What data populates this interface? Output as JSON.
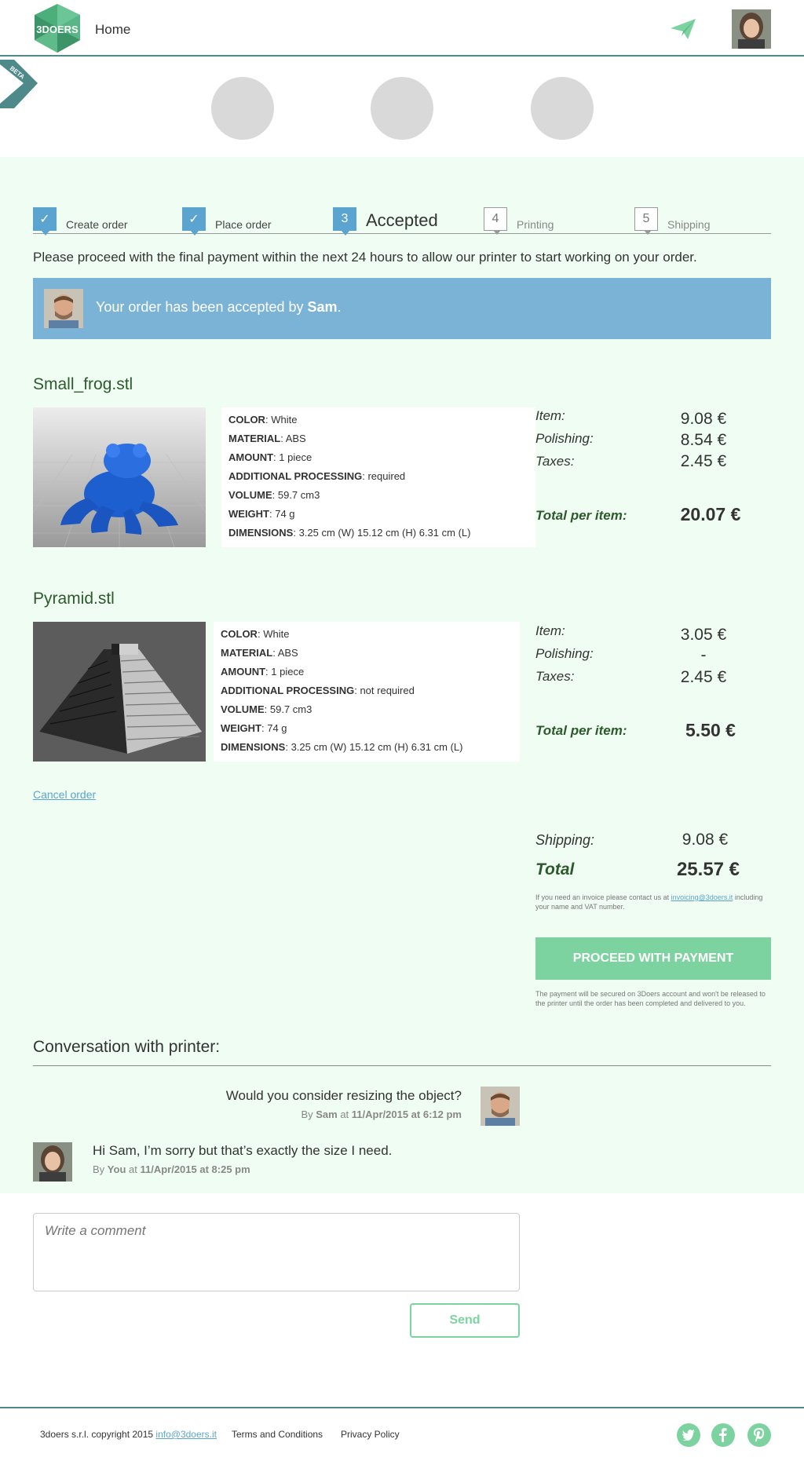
{
  "header": {
    "logo_text": "3DOERS",
    "home_label": "Home",
    "beta_label": "BETA"
  },
  "steps": [
    {
      "number": "✓",
      "label": "Create order",
      "state": "done"
    },
    {
      "number": "✓",
      "label": "Place order",
      "state": "done"
    },
    {
      "number": "3",
      "label": "Accepted",
      "state": "active"
    },
    {
      "number": "4",
      "label": "Printing",
      "state": "todo"
    },
    {
      "number": "5",
      "label": "Shipping",
      "state": "todo"
    }
  ],
  "proceed_note": "Please proceed with the final payment within the next 24 hours to allow our printer to start working on your order.",
  "banner": {
    "text_prefix": "Your order has been accepted by ",
    "printer_name": "Sam",
    "text_suffix": "."
  },
  "items": [
    {
      "title": "Small_frog.stl",
      "details": [
        {
          "label": "COLOR",
          "sep": ": ",
          "value": "White"
        },
        {
          "label": "MATERIAL",
          "sep": ": ",
          "value": "ABS"
        },
        {
          "label": "AMOUNT",
          "sep": ":  ",
          "value": "1 piece"
        },
        {
          "label": "ADDITIONAL PROCESSING",
          "sep": ":  ",
          "value": "required"
        },
        {
          "label": "VOLUME",
          "sep": ": ",
          "value": "59.7 cm3"
        },
        {
          "label": "WEIGHT",
          "sep": ": ",
          "value": "74 g"
        },
        {
          "label": "DIMENSIONS",
          "sep": ": ",
          "value": "3.25 cm (W) 15.12 cm (H) 6.31 cm (L)"
        }
      ],
      "item_label": "Item:",
      "item_price": "9.08 €",
      "polishing_label": "Polishing:",
      "polishing_price": "8.54 €",
      "taxes_label": "Taxes:",
      "taxes_price": "2.45 €",
      "total_label": "Total per item:",
      "total_price": "20.07 €"
    },
    {
      "title": "Pyramid.stl",
      "details": [
        {
          "label": "COLOR",
          "sep": ": ",
          "value": "White"
        },
        {
          "label": "MATERIAL",
          "sep": ": ",
          "value": "ABS"
        },
        {
          "label": "AMOUNT",
          "sep": ":  ",
          "value": "1 piece"
        },
        {
          "label": "ADDITIONAL PROCESSING",
          "sep": ":  ",
          "value": "not required"
        },
        {
          "label": "VOLUME",
          "sep": ": ",
          "value": "59.7 cm3"
        },
        {
          "label": "WEIGHT",
          "sep": ": ",
          "value": "74 g"
        },
        {
          "label": "DIMENSIONS",
          "sep": ": ",
          "value": "3.25 cm (W) 15.12 cm (H) 6.31 cm (L)"
        }
      ],
      "item_label": "Item:",
      "item_price": "3.05 €",
      "polishing_label": "Polishing:",
      "polishing_price": "-",
      "taxes_label": "Taxes:",
      "taxes_price": "2.45 €",
      "total_label": "Total per item:",
      "total_price": "5.50 €"
    }
  ],
  "cancel_order_label": "Cancel order",
  "summary": {
    "shipping_label": "Shipping:",
    "shipping_price": "9.08 €",
    "total_label": "Total",
    "total_price": "25.57 €",
    "invoice_note_prefix": "If you need an invoice please contact us at ",
    "invoice_email": "invoicing@3doers.it",
    "invoice_note_suffix": " including your name and VAT number.",
    "pay_button_label": "PROCEED WITH PAYMENT",
    "pay_note": "The payment will be secured on 3Doers account and won't be released to the printer until the order has been completed and delivered to you."
  },
  "conversation": {
    "title": "Conversation with printer:",
    "messages": [
      {
        "text": "Would you consider resizing the object?",
        "by": "By ",
        "author": "Sam",
        "at": " at ",
        "date": "11/Apr/2015 at 6:12 pm"
      },
      {
        "text": "Hi Sam, I’m sorry but that’s exactly the size I need.",
        "by": "By ",
        "author": "You",
        "at": " at ",
        "date": "11/Apr/2015 at 8:25 pm"
      }
    ]
  },
  "comment": {
    "placeholder": "Write a comment",
    "send_label": "Send"
  },
  "footer": {
    "copyright": "3doers s.r.l. copyright 2015 ",
    "email": "info@3doers.it",
    "terms_label": "Terms and Conditions",
    "privacy_label": "Privacy Policy",
    "social": [
      "twitter-icon",
      "facebook-icon",
      "pinterest-icon"
    ]
  },
  "colors": {
    "accent_green": "#7dd3a0",
    "accent_blue": "#5ba4cf",
    "banner_blue": "#7ab3d6",
    "content_bg": "#f0fdf2",
    "header_rule": "#4f8a8b"
  }
}
